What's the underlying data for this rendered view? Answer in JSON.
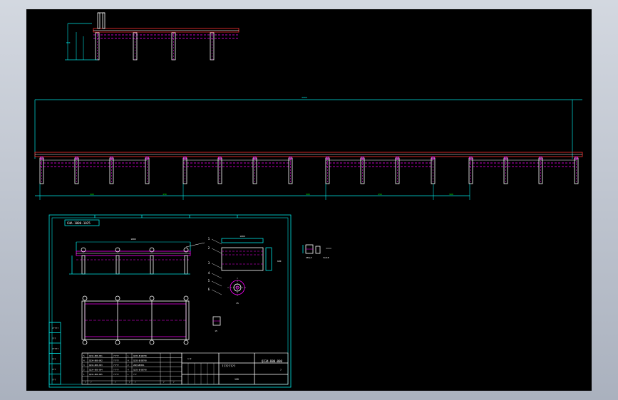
{
  "colors": {
    "background": "#000000",
    "frame": "#c2c8d2",
    "cyan": "#00e5e5",
    "magenta": "#ff00ff",
    "white": "#ffffff",
    "red": "#ff3333",
    "green": "#00ff00"
  },
  "drawing": {
    "top_overall_dim": "6000",
    "top_side_dim": "800",
    "bottom_dims": [
      "900",
      "450",
      "900",
      "450",
      "900",
      "450"
    ],
    "sheet_title_box": "CHA-1000-1025",
    "detail_overall_dim": "1800",
    "detail_section_dim": "1000",
    "detail_section_height": "600",
    "tb_label_left": [
      "?????",
      "???",
      "?????",
      "???",
      "???",
      "???"
    ],
    "bom_rows": [
      [
        "5",
        "Q234-B00-001",
        "?????",
        "1",
        "Q235-B/GB700",
        "",
        ""
      ],
      [
        "4",
        "Q234-B00-002",
        "?????",
        "4",
        "Q235-B/GB700",
        "",
        ""
      ],
      [
        "3",
        "Q234-B00-003",
        "?????",
        "2",
        "20#/GB3091",
        "",
        ""
      ],
      [
        "2",
        "Q234-B00-004",
        "?????",
        "4",
        "Q235-B/GB700",
        "",
        ""
      ],
      [
        "1",
        "Q234-B00-005",
        "?????",
        "1",
        "???",
        "",
        ""
      ]
    ],
    "bom_header": [
      "?",
      "?",
      "?",
      "?",
      "?",
      "?",
      "?"
    ],
    "title_name": "????????",
    "drawing_no": "Q234-B00-000",
    "scale_note": "1:2",
    "weight_note": "120",
    "sheet_mark": "?",
    "balloons": [
      "1",
      "2",
      "3",
      "4",
      "5",
      "6"
    ],
    "small_detail_dims": [
      "15",
      "25",
      "16"
    ],
    "side_view_labels": [
      "250±5",
      "3×∅18"
    ]
  }
}
